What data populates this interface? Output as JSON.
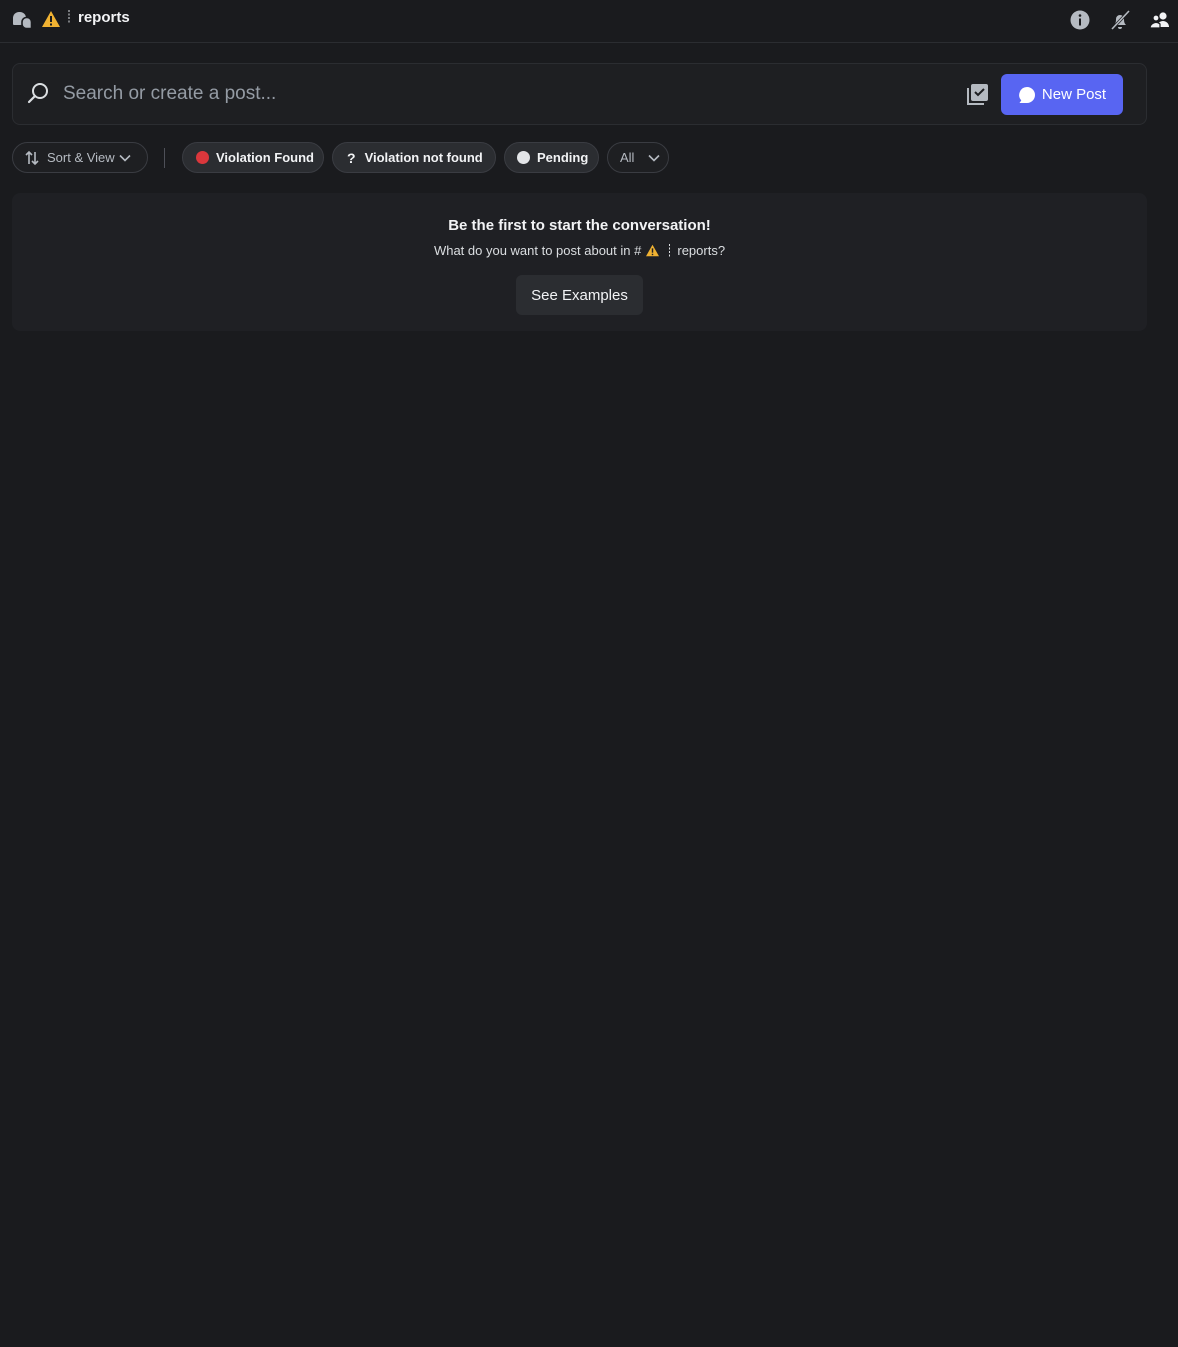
{
  "header": {
    "channel_name": "reports",
    "icons": {
      "forum": "forum-channel-icon",
      "warning": "warning-icon",
      "info": "info-icon",
      "mute": "notifications-off-icon",
      "members": "members-icon"
    }
  },
  "search": {
    "placeholder": "Search or create a post..."
  },
  "new_post": {
    "label": "New Post"
  },
  "filters": {
    "sort_label": "Sort & View",
    "tags": [
      {
        "label": "Violation Found",
        "color": "#da373c"
      },
      {
        "label": "Violation not found",
        "icon": "?"
      },
      {
        "label": "Pending",
        "color": "#e3e5e8"
      }
    ],
    "all_label": "All"
  },
  "empty_state": {
    "title": "Be the first to start the conversation!",
    "subtitle_prefix": "What do you want to post about in #",
    "subtitle_suffix": "reports?",
    "button_label": "See Examples"
  },
  "colors": {
    "background": "#1a1b1e",
    "accent": "#5865f2",
    "warning": "#f0b232"
  }
}
